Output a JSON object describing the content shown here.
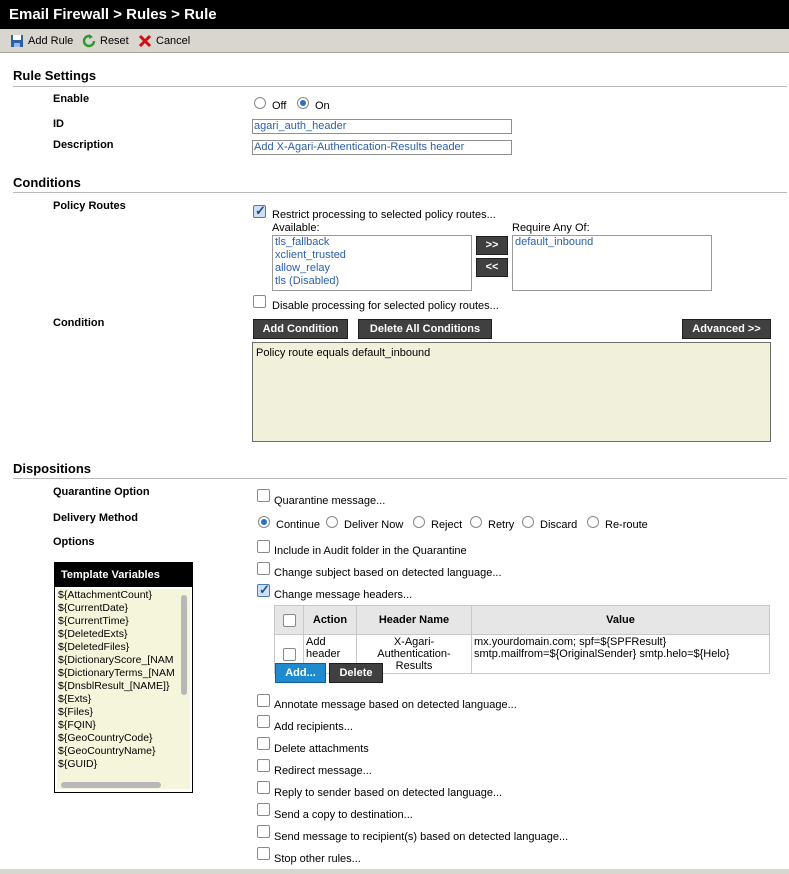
{
  "title": "Email Firewall > Rules > Rule",
  "toolbar": {
    "add_rule": "Add Rule",
    "reset": "Reset",
    "cancel": "Cancel"
  },
  "rule_settings": {
    "heading": "Rule Settings",
    "enable_label": "Enable",
    "enable_off": "Off",
    "enable_on": "On",
    "enabled": "On",
    "id_label": "ID",
    "id_value": "agari_auth_header",
    "desc_label": "Description",
    "desc_value": "Add X-Agari-Authentication-Results header"
  },
  "conditions": {
    "heading": "Conditions",
    "policy_routes_label": "Policy Routes",
    "restrict_label": "Restrict processing to selected policy routes...",
    "available_label": "Available:",
    "available": [
      "tls_fallback",
      "xclient_trusted",
      "allow_relay",
      "tls (Disabled)"
    ],
    "require_label": "Require Any Of:",
    "required": [
      "default_inbound"
    ],
    "move_right": ">>",
    "move_left": "<<",
    "disable_label": "Disable processing for selected policy routes...",
    "condition_label": "Condition",
    "add_condition": "Add Condition",
    "delete_all": "Delete All Conditions",
    "advanced": "Advanced >>",
    "condition_text": "Policy route equals default_inbound"
  },
  "dispositions": {
    "heading": "Dispositions",
    "quarantine_label": "Quarantine Option",
    "quarantine_msg": "Quarantine message...",
    "delivery_label": "Delivery Method",
    "delivery_options": [
      "Continue",
      "Deliver Now",
      "Reject",
      "Retry",
      "Discard",
      "Re-route"
    ],
    "delivery_selected": "Continue",
    "options_label": "Options",
    "options": {
      "audit": "Include in Audit folder in the Quarantine",
      "change_subject": "Change subject based on detected language...",
      "change_headers": "Change message headers...",
      "annotate": "Annotate message based on detected language...",
      "add_recipients": "Add recipients...",
      "delete_attachments": "Delete attachments",
      "redirect": "Redirect message...",
      "reply": "Reply to sender based on detected language...",
      "send_copy": "Send a copy to destination...",
      "send_recipients": "Send message to recipient(s) based on detected language...",
      "stop_rules": "Stop other rules..."
    },
    "header_table": {
      "columns": [
        "Action",
        "Header Name",
        "Value"
      ],
      "row": {
        "action_l1": "Add",
        "action_l2": "header",
        "name_l1": "X-Agari-",
        "name_l2": "Authentication-Results",
        "value_l1": "mx.yourdomain.com; spf=${SPFResult}",
        "value_l2": "smtp.mailfrom=${OriginalSender} smtp.helo=${Helo}"
      },
      "add_btn": "Add...",
      "delete_btn": "Delete"
    },
    "template_vars": {
      "heading": "Template Variables",
      "items": [
        "${AttachmentCount}",
        "${CurrentDate}",
        "${CurrentTime}",
        "${DeletedExts}",
        "${DeletedFiles}",
        "${DictionaryScore_[NAM",
        "${DictionaryTerms_[NAM",
        "${DnsblResult_[NAME]}",
        "${Exts}",
        "${Files}",
        "${FQIN}",
        "${GeoCountryCode}",
        "${GeoCountryName}",
        "${GUID}"
      ]
    }
  }
}
